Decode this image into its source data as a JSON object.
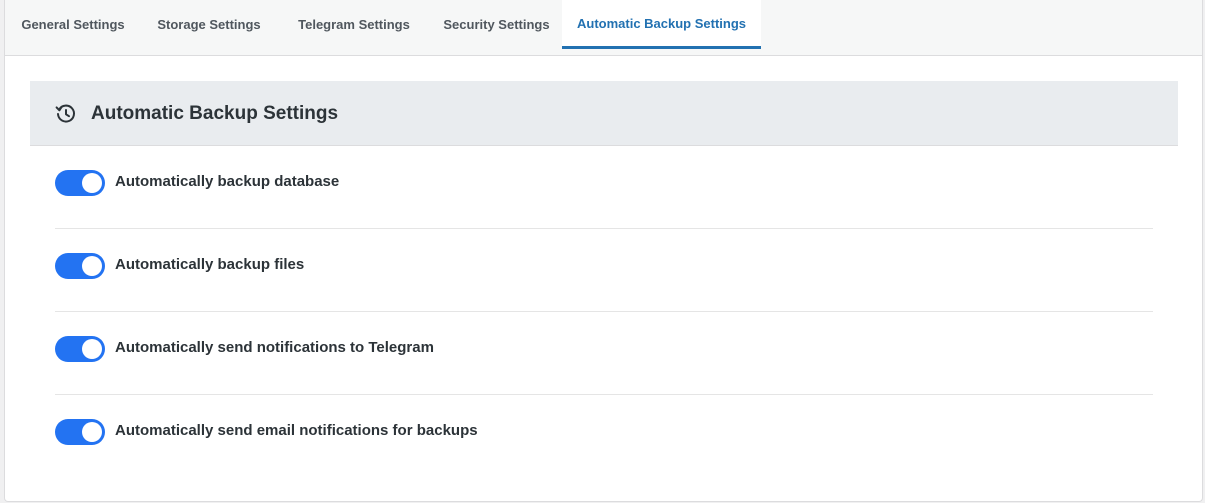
{
  "tabs": [
    {
      "label": "General Settings",
      "active": false
    },
    {
      "label": "Storage Settings",
      "active": false
    },
    {
      "label": "Telegram Settings",
      "active": false
    },
    {
      "label": "Security Settings",
      "active": false
    },
    {
      "label": "Automatic Backup Settings",
      "active": true
    }
  ],
  "section": {
    "icon": "history-icon",
    "title": "Automatic Backup Settings"
  },
  "settings": [
    {
      "label": "Automatically backup database",
      "enabled": true
    },
    {
      "label": "Automatically backup files",
      "enabled": true
    },
    {
      "label": "Automatically send notifications to Telegram",
      "enabled": true
    },
    {
      "label": "Automatically send email notifications for backups",
      "enabled": true
    }
  ],
  "colors": {
    "accent": "#2271b1",
    "toggle_on": "#2373f2",
    "header_bg": "#e9ecef"
  }
}
